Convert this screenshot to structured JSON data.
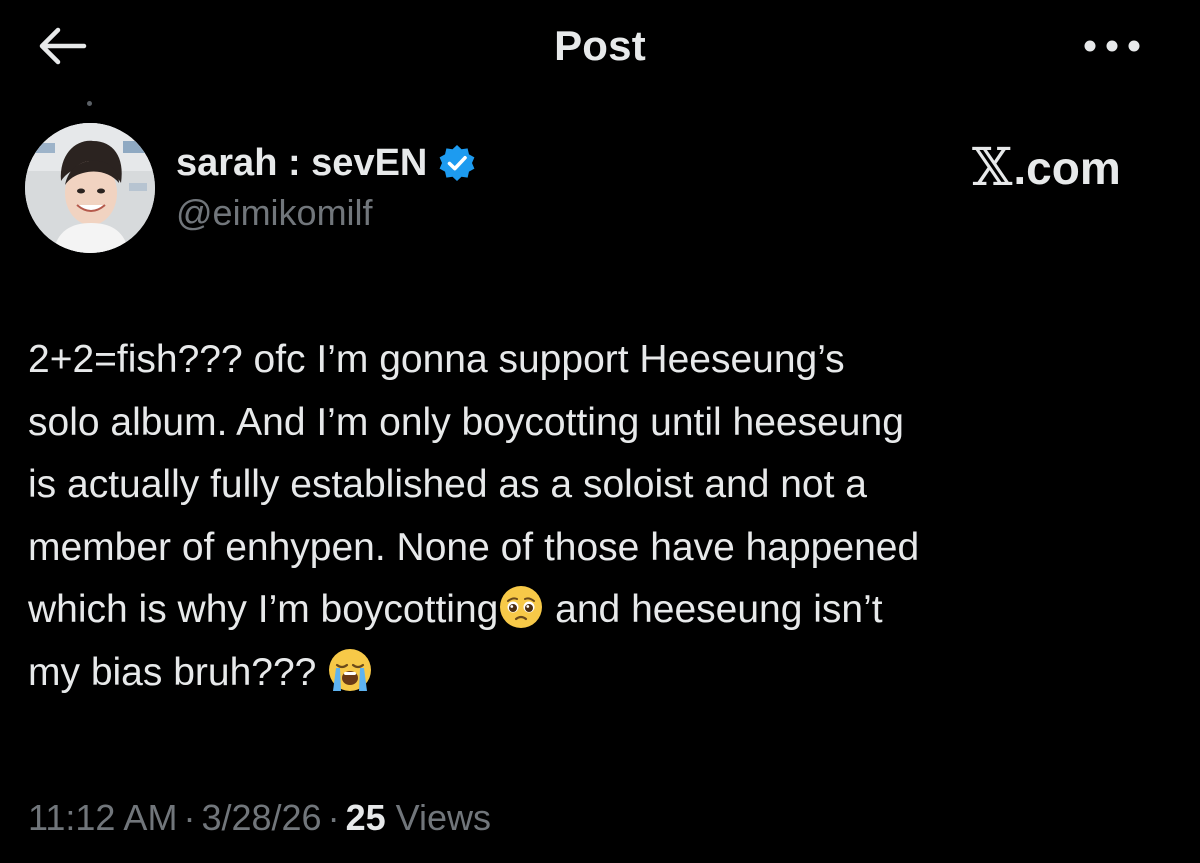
{
  "header": {
    "title": "Post",
    "back_icon": "arrow-left-icon",
    "more_icon": "more-horizontal-icon"
  },
  "author": {
    "display_name": "sarah : sevEN",
    "handle": "@eimikomilf",
    "verified_icon": "verified-badge-icon",
    "verified_color": "#1d9bf0"
  },
  "watermark": {
    "logo": "𝕏",
    "text": ".com"
  },
  "post": {
    "lines": [
      "2+2=fish??? ofc I’m gonna support Heeseung’s",
      "solo album. And I’m only boycotting until heeseung",
      "is actually fully established as a soloist and not a",
      "member of enhypen. None of those have happened",
      "which is why I’m boycotting",
      " and heeseung isn’t",
      "my bias bruh???"
    ],
    "emojis": [
      "pleading-face-emoji",
      "loudly-crying-face-emoji"
    ]
  },
  "meta": {
    "time": "11:12 AM",
    "separator": "·",
    "date": "3/28/26",
    "views_count": "25",
    "views_label": "Views"
  },
  "colors": {
    "background": "#000000",
    "primary_text": "#e7e9ea",
    "secondary_text": "#71767b",
    "accent": "#1d9bf0"
  }
}
